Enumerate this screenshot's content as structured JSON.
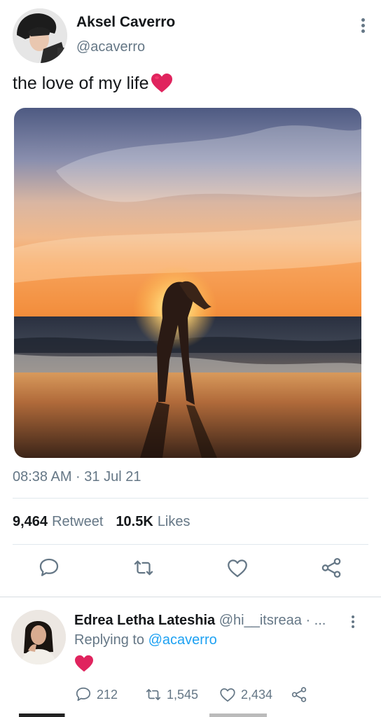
{
  "tweet": {
    "author_name": "Aksel Caverro",
    "author_handle": "@acaverro",
    "text": "the love of my life",
    "emoji": "heart",
    "timestamp": "08:38 AM · 31 Jul 21",
    "retweet_count": "9,464",
    "retweet_label": "Retweet",
    "like_count": "10.5K",
    "like_label": "Likes"
  },
  "actions": [
    "reply-icon",
    "retweet-icon",
    "like-icon",
    "share-icon"
  ],
  "reply": {
    "name": "Edrea Letha Lateshia",
    "handle": "@hi__itsreaa · ...",
    "replying_prefix": "Replying to",
    "replying_to": "@acaverro",
    "emoji": "heart",
    "reply_count": "212",
    "retweet_count": "1,545",
    "like_count": "2,434"
  },
  "colors": {
    "accent": "#1da1f2",
    "text_primary": "#14171a",
    "text_secondary": "#657786",
    "heart": "#e0245e"
  }
}
